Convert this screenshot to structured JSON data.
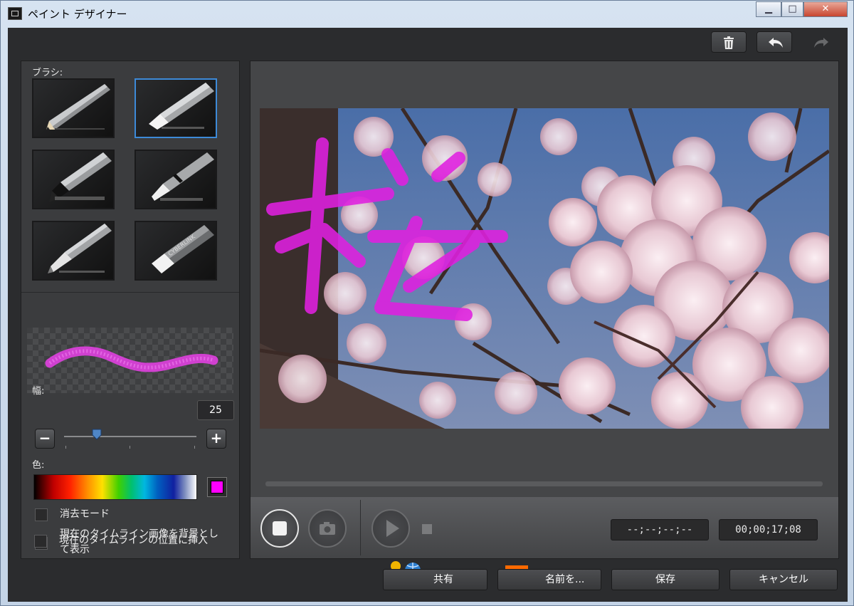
{
  "window": {
    "title": "ペイント デザイナー",
    "min_glyph": "▁",
    "max_glyph": "□",
    "close_glyph": "✕"
  },
  "toolbar": {
    "delete_icon": "trash-icon",
    "undo_icon": "undo-icon",
    "redo_icon": "redo-icon",
    "redo_enabled": false
  },
  "brush_panel": {
    "label": "ブラシ:",
    "brushes": [
      {
        "icon": "pencil-icon",
        "selected": false
      },
      {
        "icon": "chalk-icon",
        "selected": true
      },
      {
        "icon": "marker-icon",
        "selected": false
      },
      {
        "icon": "crayon-icon",
        "selected": false
      },
      {
        "icon": "fountain-pen-icon",
        "selected": false
      },
      {
        "icon": "eraser-icon",
        "selected": false,
        "brand_text": "CYBERLINK"
      }
    ],
    "stroke_color": "#e040e0"
  },
  "width": {
    "label": "幅:",
    "value": "25",
    "slider_level": 0.25,
    "minus": "−",
    "plus": "+"
  },
  "color": {
    "label": "色:",
    "selected": "#ff00ff"
  },
  "options": [
    {
      "label": "消去モード",
      "checked": false,
      "mark": ""
    },
    {
      "label_line1": "現在のタイムライン画像を背景とし",
      "label_line2": "て表示",
      "checked": true,
      "mark": "✓"
    },
    {
      "label": "現在のタイムラインの位置に挿入",
      "checked": false,
      "mark": ""
    }
  ],
  "canvas": {
    "drawn_character": "桜",
    "ink_color": "#e020e0"
  },
  "playback": {
    "progress": 0.0,
    "stop_icon": "record-stop-icon",
    "snapshot_icon": "camera-icon",
    "play_icon": "play-icon",
    "small_stop_icon": "stop-icon",
    "timecode_blank": "--;--;--;--",
    "timecode": "00;00;17;08"
  },
  "footer": {
    "share": "共有",
    "save_as": "名前を...",
    "save": "保存",
    "cancel": "キャンセル"
  }
}
